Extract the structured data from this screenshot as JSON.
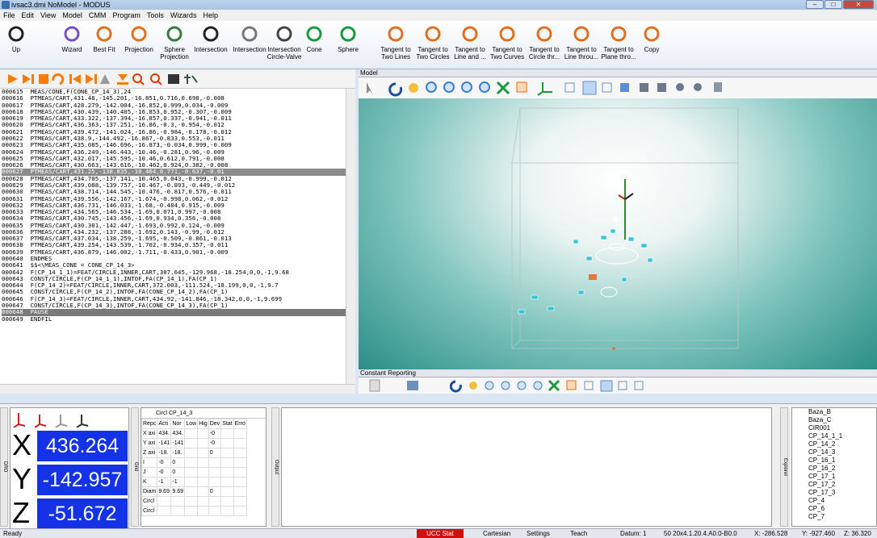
{
  "title": "ivsac3.dmi   NoModel  - MODUS",
  "menu": [
    "File",
    "Edit",
    "View",
    "Model",
    "CMM",
    "Program",
    "Tools",
    "Wizards",
    "Help"
  ],
  "toolbar": [
    "Up",
    "Wizard",
    "Best Fit",
    "Projection",
    "Sphere Projection",
    "Intersection",
    "Intersection",
    "Intersection Circle-Valve",
    "Cone",
    "Sphere",
    "Tangent to Two Lines",
    "Tangent to Two Circles",
    "Tangent to Line and ...",
    "Tangent to Two Curves",
    "Tangent to Circle thr...",
    "Tangent to Line throu...",
    "Tangent to Plane thro...",
    "Copy"
  ],
  "code": [
    "000615  MEAS/CONE,F(CONE_CP_14_3),24",
    "000616  PTMEAS/CART,431.48,-145.201,-16.851,0.716,0.698,-0.008",
    "000617  PTMEAS/CART,428.279,-142.004,-16.852,0.999,0.034,-0.009",
    "000618  PTMEAS/CART,430.439,-140.405,-16.853,0.952,-0.307,-0.009",
    "000619  PTMEAS/CART,433.322,-137.394,-16.857,0.337,-0.941,-0.011",
    "000620  PTMEAS/CART,436.363,-137.251,-16.86,-0.3,-0.954,-0.012",
    "000621  PTMEAS/CART,439.472,-141.024,-16.86,-0.984,-0.178,-0.012",
    "000622  PTMEAS/CART,438.9,-144.492,-16.867,-0.833,0.553,-0.011",
    "000623  PTMEAS/CART,435.085,-146.696,-16.873,-0.034,0.999,-0.009",
    "000624  PTMEAS/CART,436.249,-146.443,-10.46,-0.281,0.96,-0.009",
    "000625  PTMEAS/CART,432.017,-145.595,-10.46,0.612,0.791,-0.008",
    "000626  PTMEAS/CART,430.663,-143.616,-10.462,0.924,0.382,-0.008",
    "000627  PTMEAS/CART,431.25,-138.835,-10.464,0.771,-0.637,-0.01",
    "000628  PTMEAS/CART,434.705,-137.141,-10.465,0.043,-0.999,-0.012",
    "000629  PTMEAS/CART,439.088,-139.757,-10.467,-0.893,-0.449,-0.012",
    "000630  PTMEAS/CART,438.714,-144.545,-10.476,-0.817,0.576,-0.011",
    "000631  PTMEAS/CART,439.556,-142.167,-1.674,-0.998,0.062,-0.012",
    "000632  PTMEAS/CART,436.731,-146.033,-1.68,-0.484,0.915,-0.009",
    "000633  PTMEAS/CART,434.565,-146.534,-1.69,0.071,0.997,-0.008",
    "000634  PTMEAS/CART,430.745,-143.456,-1.69,0.934,0.356,-0.008",
    "000635  PTMEAS/CART,430.301,-142.447,-1.693,0.992,0.124,-0.009",
    "000636  PTMEAS/CART,434.232,-137.288,-1.692,0.143,-0.99,-0.012",
    "000637  PTMEAS/CART,437.034,-138.259,-1.695,-0.509,-0.861,-0.013",
    "000638  PTMEAS/CART,439.254,-143.539,-1.702,-0.934,0.357,-0.011",
    "000639  PTMEAS/CART,436.879,-146.002,-1.711,-0.433,0.901,-0.009",
    "000640  ENDMES",
    "000641  $$<\\MEAS_CONE = CONE_CP_14_3>",
    "000642  F(CP_14_1_1)=FEAT/CIRCLE,INNER,CART,307.645,-129.968,-18.254,0,0,-1,9.68",
    "000643  CONST/CIRCLE,F(CP_14_1_1),INTOF,FA(CP_14_1),FA(CP_1)",
    "000644  F(CP_14_2)=FEAT/CIRCLE,INNER,CART,372.003,-111.524,-18.199,0,0,-1,9.7",
    "000645  CONST/CIRCLE,F(CP_14_2),INTOF,FA(CONE_CP_14_2),FA(CP_1)",
    "000646  F(CP_14_3)=FEAT/CIRCLE,INNER,CART,434.92,-141.846,-18.342,0,0,-1,9.699",
    "000647  CONST/CIRCLE,F(CP_14_3),INTOF,FA(CONE_CP_14_3),FA(CP_1)",
    "000648  PAUSE",
    "000649  ENDFIL"
  ],
  "model_label": "Model",
  "cr_label": "Constant Reporting",
  "dro": {
    "x": "436.264",
    "y": "-142.957",
    "z": "-51.672",
    "X": "X",
    "Y": "Y",
    "Z": "Z"
  },
  "grid": {
    "title": "Circl CP_14_3",
    "header": [
      "Repc",
      "Acti",
      "Nor",
      "Low",
      "Hig",
      "Dev",
      "Stat",
      "Erro"
    ],
    "rows": [
      [
        "X axi",
        "434.",
        "434.",
        "",
        "",
        "-0",
        "",
        ""
      ],
      [
        "Y axi",
        "-141",
        "-141",
        "",
        "",
        "-0",
        "",
        ""
      ],
      [
        "Z axi",
        "-18.",
        "-18.",
        "",
        "",
        "0",
        "",
        ""
      ],
      [
        "I",
        "-0",
        "0",
        "",
        "",
        "",
        "",
        ""
      ],
      [
        "J",
        "-0",
        "0",
        "",
        "",
        "",
        "",
        ""
      ],
      [
        "K",
        "-1",
        "-1",
        "",
        "",
        "",
        "",
        ""
      ],
      [
        "Diam",
        "9.69",
        "9.69",
        "",
        "",
        "0",
        "",
        ""
      ],
      [
        "Circl",
        "",
        "",
        "",
        "",
        "",
        "",
        ""
      ],
      [
        "Circl",
        "",
        "",
        "",
        "",
        "",
        "",
        ""
      ]
    ]
  },
  "side_labels": {
    "dro": "DRO",
    "grid": "Grid",
    "output": "Output",
    "explorer": "Explorer"
  },
  "explorer": [
    "Baza_B",
    "Baza_C",
    "CIR001",
    "CP_14_1_1",
    "CP_14_2",
    "CP_14_3",
    "CP_16_1",
    "CP_16_2",
    "CP_17_1",
    "CP_17_2",
    "CP_17_3",
    "CP_4",
    "CP_6",
    "CP_7"
  ],
  "status": {
    "ready": "Ready",
    "red": "UCC Stat",
    "cartesian": "Cartesian",
    "settings": "Settings",
    "teach": "Teach",
    "datum": "Datum: 1",
    "probe": "50 20x4.1.20.4.A0.0-B0.0",
    "x": "X: -286.528",
    "y": "Y: -927.460",
    "z": "Z: 36.320"
  },
  "colors": {
    "dro_bg": "#1433e6",
    "viewport": "#2a8f88",
    "toolbar_arrows": "#ff6a00",
    "status_red": "#d01010"
  }
}
